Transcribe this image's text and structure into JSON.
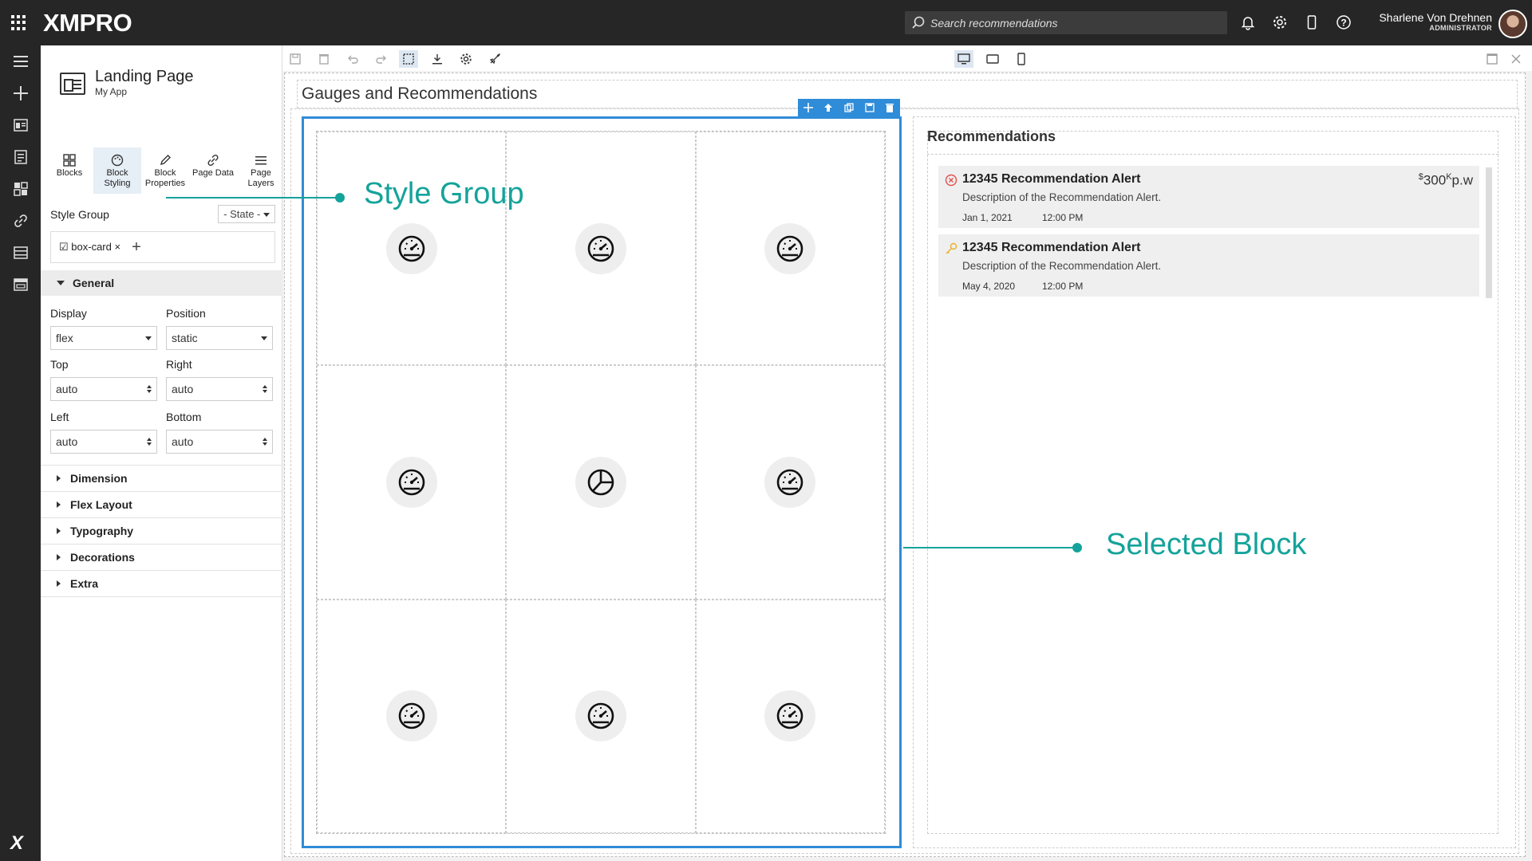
{
  "app": {
    "logo": "XMPRO"
  },
  "search": {
    "placeholder": "Search recommendations"
  },
  "user": {
    "name": "Sharlene Von Drehnen",
    "role": "ADMINISTRATOR"
  },
  "page": {
    "title": "Landing Page",
    "subtitle": "My App"
  },
  "tabs": [
    {
      "label": "Blocks",
      "icon": "blocks-icon"
    },
    {
      "label": "Block Styling",
      "icon": "palette-icon"
    },
    {
      "label": "Block Properties",
      "icon": "pencil-icon"
    },
    {
      "label": "Page Data",
      "icon": "link-icon"
    },
    {
      "label": "Page Layers",
      "icon": "layers-icon"
    }
  ],
  "style_group": {
    "label": "Style Group",
    "state": "- State -",
    "tag": "box-card"
  },
  "general": {
    "label": "General",
    "display_label": "Display",
    "display_value": "flex",
    "position_label": "Position",
    "position_value": "static",
    "top_label": "Top",
    "top_value": "auto",
    "right_label": "Right",
    "right_value": "auto",
    "left_label": "Left",
    "left_value": "auto",
    "bottom_label": "Bottom",
    "bottom_value": "auto"
  },
  "sections": [
    "Dimension",
    "Flex Layout",
    "Typography",
    "Decorations",
    "Extra"
  ],
  "canvas": {
    "heading": "Gauges and Recommendations"
  },
  "gauges": [
    "gauge",
    "gauge",
    "gauge",
    "gauge",
    "pie",
    "gauge",
    "gauge",
    "gauge",
    "gauge"
  ],
  "recommendations": {
    "title": "Recommendations",
    "items": [
      {
        "title": "12345 Recommendation Alert",
        "description": "Description of the Recommendation Alert.",
        "date": "Jan 1, 2021",
        "time": "12:00 PM",
        "price_sup": "$",
        "price": "300",
        "price_unit_sup": "K",
        "price_unit": "p.w",
        "status": "error",
        "status_color": "#e05050"
      },
      {
        "title": "12345 Recommendation Alert",
        "description": "Description of the Recommendation Alert.",
        "date": "May 4, 2020",
        "time": "12:00 PM",
        "status": "key",
        "status_color": "#e8b030"
      }
    ]
  },
  "annotations": {
    "style_group": "Style Group",
    "selected_block": "Selected Block"
  },
  "colors": {
    "accent": "#2f8cd8",
    "annotation": "#14a39a",
    "dark": "#262626"
  }
}
